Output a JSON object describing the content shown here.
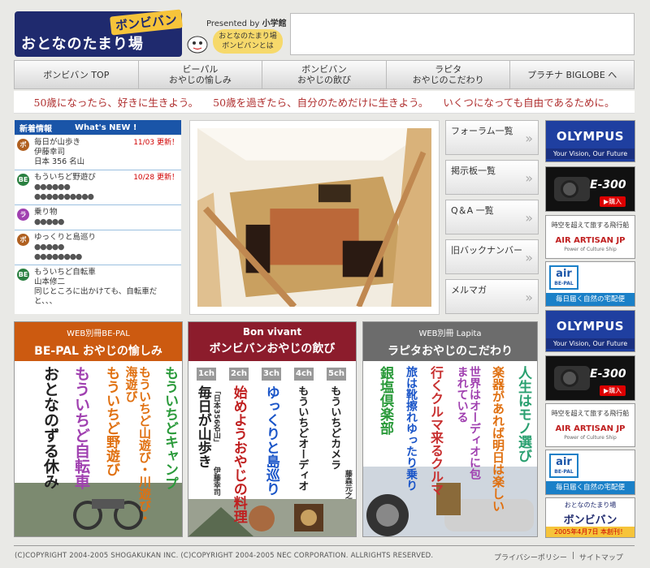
{
  "header": {
    "logo_main": "おとなのたまり場",
    "logo_sub": "ボンビバン",
    "presented_by": "Presented by",
    "publisher": "小学館",
    "bubble_line1": "おとなのたまり場",
    "bubble_line2": "ボンビバンとは"
  },
  "nav": [
    {
      "l1": "ボンビバン TOP",
      "l2": ""
    },
    {
      "l1": "ビーパル",
      "l2": "おやじの愉しみ"
    },
    {
      "l1": "ボンビバン",
      "l2": "おやじの飲び"
    },
    {
      "l1": "ラピタ",
      "l2": "おやじのこだわり"
    },
    {
      "l1": "プラチナ BIGLOBE へ",
      "l2": ""
    }
  ],
  "taglines": [
    "50歳になったら、好きに生きよう。",
    "50歳を過ぎたら、自分のためだけに生きよう。",
    "いくつになっても自由であるために。"
  ],
  "news": {
    "title": "新着情報",
    "title_en": "What's NEW !",
    "items": [
      {
        "badge": "ボ",
        "l1": "毎日が山歩き",
        "l2": "伊藤幸司",
        "l3": "日本 356 名山",
        "update": "11/03 更新！"
      },
      {
        "badge": "BE",
        "l1": "もういちど野遊び",
        "l2": "●●●●●●",
        "l3": "●●●●●●●●●●",
        "update": "10/28 更新！"
      },
      {
        "badge": "ラ",
        "l1": "乗り物",
        "l2": "●●●●●",
        "l3": "",
        "update": ""
      },
      {
        "badge": "ボ",
        "l1": "ゆっくりと島巡り",
        "l2": "●●●●●",
        "l3": "●●●●●●●●",
        "update": ""
      },
      {
        "badge": "BE",
        "l1": "もういちど自転車",
        "l2": "山本修二",
        "l3": "同じところに出かけても、自転車だと、、、",
        "update": ""
      }
    ]
  },
  "side_buttons": [
    "フォーラム一覧",
    "掲示板一覧",
    "Q＆A 一覧",
    "旧バックナンバー",
    "メルマガ"
  ],
  "ads": {
    "olympus_brand": "OLYMPUS",
    "olympus_slogan": "Your Vision, Our Future",
    "camera_model": "E-300",
    "buy": "▶購入",
    "air_line1": "時空を超えて旅する飛行船",
    "air_line2": "AIR ARTISAN JP",
    "air_line3": "Power of Culture Ship",
    "bepal_logo": "air",
    "bepal_sub": "BE-PAL",
    "bepal_caption": "毎日届く自然の宅配便",
    "bompi_line1": "おとなのたまり場",
    "bompi_line2": "ボンビバン",
    "bompi_line3": "2005年4月7日 本創刊！"
  },
  "panels": {
    "bepal": {
      "sub": "WEB別冊BE-PAL",
      "title": "BE-PAL おやじの愉しみ",
      "cols": [
        "もういちどキャンプ",
        "もういちど山遊び・川遊び・海遊び",
        "もういちど野遊び",
        "もういちど自転車",
        "おとなのずる休み"
      ]
    },
    "bon": {
      "sub": "Bon vivant",
      "title": "ボンビバンおやじの飲び",
      "channels": [
        "1ch",
        "2ch",
        "3ch",
        "4ch",
        "5ch"
      ],
      "cols": [
        "毎日が山歩き",
        "始めようおやじの料理",
        "ゆっくりと島巡り",
        "もういちどオーディオ",
        "もういちどカメラ"
      ],
      "subcols": [
        "「日本356名山」",
        "伊藤幸司",
        "藤森元之"
      ]
    },
    "lapita": {
      "sub": "WEB別冊 Lapita",
      "title": "ラピタおやじのこだわり",
      "cols": [
        "人生はモノ選び",
        "楽器があれば明日は楽しい",
        "世界はオーディオに包まれている",
        "行くクルマ来るクルマ",
        "旅は靴擦れゆったり乗り",
        "銀塩倶楽部"
      ]
    }
  },
  "footer": {
    "copyright": "(C)COPYRIGHT 2004-2005 SHOGAKUKAN INC.  (C)COPYRIGHT 2004-2005 NEC CORPORATION. ALLRIGHTS RESERVED.",
    "privacy": "プライバシーポリシー",
    "separator": "|",
    "sitemap": "サイトマップ"
  },
  "colors": {
    "logo_bg": "#1f2a6e",
    "news_head": "#1a55a8",
    "bepal": "#cc5a10",
    "bon": "#8c1c2c",
    "lapita": "#6c6c6c",
    "tagline": "#b03030"
  }
}
